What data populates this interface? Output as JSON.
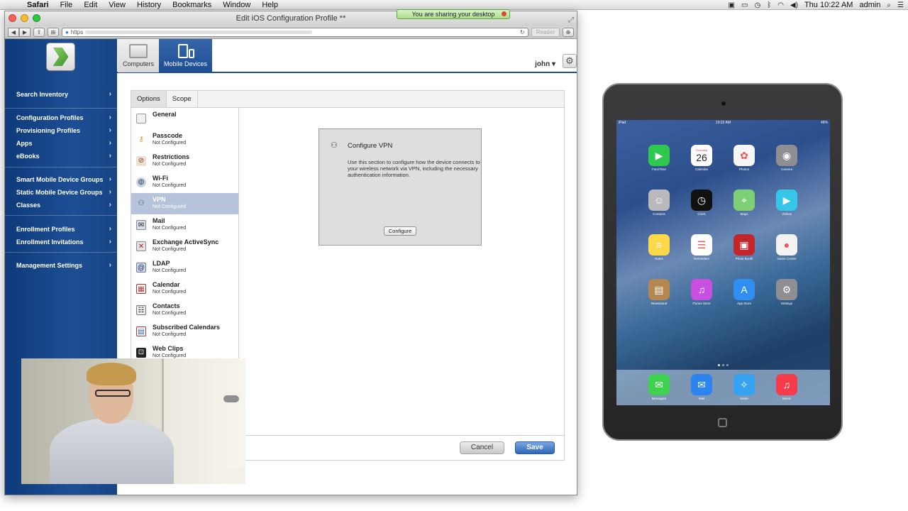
{
  "menubar": {
    "items": [
      "Safari",
      "File",
      "Edit",
      "View",
      "History",
      "Bookmarks",
      "Window",
      "Help"
    ],
    "clock": "Thu 10:22 AM",
    "user": "admin"
  },
  "browser": {
    "title": "Edit iOS Configuration Profile **",
    "url_prefix": "https",
    "reader_label": "Reader"
  },
  "share_banner": {
    "text": "You are sharing your desktop"
  },
  "topbar": {
    "tabs": [
      {
        "label": "Computers"
      },
      {
        "label": "Mobile Devices"
      }
    ],
    "user": "john ▾"
  },
  "sidebar": {
    "items": [
      {
        "label": "Search Inventory"
      },
      {
        "label": "Configuration Profiles"
      },
      {
        "label": "Provisioning Profiles"
      },
      {
        "label": "Apps"
      },
      {
        "label": "eBooks"
      },
      {
        "label": "Smart Mobile Device Groups"
      },
      {
        "label": "Static Mobile Device Groups"
      },
      {
        "label": "Classes"
      },
      {
        "label": "Enrollment Profiles"
      },
      {
        "label": "Enrollment Invitations"
      },
      {
        "label": "Management Settings"
      }
    ]
  },
  "panel": {
    "tabs": [
      {
        "label": "Options"
      },
      {
        "label": "Scope"
      }
    ],
    "payloads": [
      {
        "name": "General",
        "status": ""
      },
      {
        "name": "Passcode",
        "status": "Not Configured"
      },
      {
        "name": "Restrictions",
        "status": "Not Configured"
      },
      {
        "name": "Wi-Fi",
        "status": "Not Configured"
      },
      {
        "name": "VPN",
        "status": "Not Configured"
      },
      {
        "name": "Mail",
        "status": "Not Configured"
      },
      {
        "name": "Exchange ActiveSync",
        "status": "Not Configured"
      },
      {
        "name": "LDAP",
        "status": "Not Configured"
      },
      {
        "name": "Calendar",
        "status": "Not Configured"
      },
      {
        "name": "Contacts",
        "status": "Not Configured"
      },
      {
        "name": "Subscribed Calendars",
        "status": "Not Configured"
      },
      {
        "name": "Web Clips",
        "status": "Not Configured"
      }
    ],
    "vpn": {
      "title": "Configure VPN",
      "description": "Use this section to configure how the device connects to your wireless network via VPN, including the necessary authentication information.",
      "button": "Configure"
    },
    "cancel": "Cancel",
    "save": "Save"
  },
  "ipad": {
    "status_left": "iPad",
    "status_time": "10:22 AM",
    "status_right": "46%",
    "calendar_day": "Thursday",
    "calendar_date": "26",
    "apps": [
      {
        "label": "FaceTime",
        "icon": "facetime-icon",
        "color": "#2fc84f"
      },
      {
        "label": "Calendar",
        "icon": "calendar-icon",
        "color": "#ffffff"
      },
      {
        "label": "Photos",
        "icon": "photos-icon",
        "color": "#f6f6f6"
      },
      {
        "label": "Camera",
        "icon": "camera-icon",
        "color": "#8e8e93"
      },
      {
        "label": "Contacts",
        "icon": "contacts-icon",
        "color": "#b9b9be"
      },
      {
        "label": "Clock",
        "icon": "clock-icon",
        "color": "#111111"
      },
      {
        "label": "Maps",
        "icon": "maps-icon",
        "color": "#7fcf77"
      },
      {
        "label": "Videos",
        "icon": "videos-icon",
        "color": "#35c6e8"
      },
      {
        "label": "Notes",
        "icon": "notes-icon",
        "color": "#fdd94a"
      },
      {
        "label": "Reminders",
        "icon": "reminders-icon",
        "color": "#ffffff"
      },
      {
        "label": "Photo Booth",
        "icon": "photo-booth-icon",
        "color": "#c0262a"
      },
      {
        "label": "Game Center",
        "icon": "game-center-icon",
        "color": "#f2f2f2"
      },
      {
        "label": "Newsstand",
        "icon": "newsstand-icon",
        "color": "#b3874f"
      },
      {
        "label": "iTunes Store",
        "icon": "itunes-store-icon",
        "color": "#c84fe0"
      },
      {
        "label": "App Store",
        "icon": "app-store-icon",
        "color": "#2f8ef0"
      },
      {
        "label": "Settings",
        "icon": "settings-icon",
        "color": "#8e8e93"
      }
    ],
    "dock": [
      {
        "label": "Messages",
        "icon": "messages-icon",
        "color": "#3fd14f"
      },
      {
        "label": "Mail",
        "icon": "mail-icon",
        "color": "#2e84ef"
      },
      {
        "label": "Safari",
        "icon": "safari-icon",
        "color": "#36a3f2"
      },
      {
        "label": "Music",
        "icon": "music-icon",
        "color": "#f63c4b"
      }
    ]
  }
}
